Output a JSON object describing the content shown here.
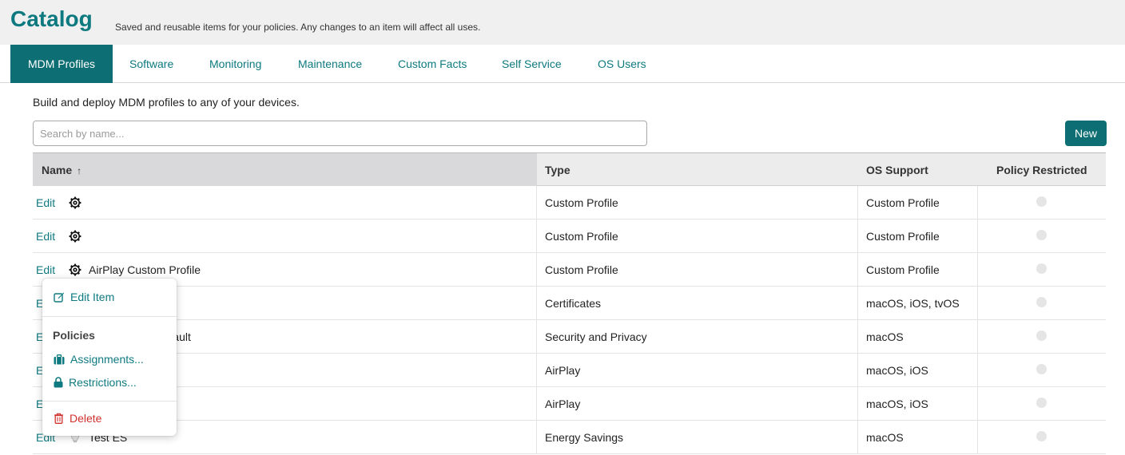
{
  "header": {
    "title": "Catalog",
    "subtitle": "Saved and reusable items for your policies. Any changes to an item will affect all uses."
  },
  "tabs": [
    {
      "label": "MDM Profiles",
      "active": true
    },
    {
      "label": "Software"
    },
    {
      "label": "Monitoring"
    },
    {
      "label": "Maintenance"
    },
    {
      "label": "Custom Facts"
    },
    {
      "label": "Self Service"
    },
    {
      "label": "OS Users"
    }
  ],
  "main": {
    "description": "Build and deploy MDM profiles to any of your devices.",
    "search_placeholder": "Search by name...",
    "new_label": "New"
  },
  "table": {
    "columns": {
      "name": "Name",
      "sort_indicator": "↑",
      "type": "Type",
      "os": "OS Support",
      "restricted": "Policy Restricted"
    },
    "rows": [
      {
        "edit": "Edit",
        "icon": "gear-icon",
        "name": "",
        "type": "Custom Profile",
        "os": "Custom Profile"
      },
      {
        "edit": "Edit",
        "icon": "gear-icon",
        "name": "",
        "type": "Custom Profile",
        "os": "Custom Profile"
      },
      {
        "edit": "Edit",
        "icon": "gear-icon",
        "name": "AirPlay Custom Profile",
        "type": "Custom Profile",
        "os": "Custom Profile"
      },
      {
        "edit": "E",
        "name": "",
        "type": "Certificates",
        "os": "macOS, iOS, tvOS"
      },
      {
        "edit": "E",
        "name": "Vault",
        "type": "Security and Privacy",
        "os": "macOS"
      },
      {
        "edit": "E",
        "name": "",
        "type": "AirPlay",
        "os": "macOS, iOS"
      },
      {
        "edit": "E",
        "name": "",
        "type": "AirPlay",
        "os": "macOS, iOS"
      },
      {
        "edit": "Edit",
        "icon": "lightbulb-icon",
        "name": "Test ES",
        "type": "Energy Savings",
        "os": "macOS"
      }
    ]
  },
  "context_menu": {
    "edit_item": "Edit Item",
    "section_title": "Policies",
    "assignments": "Assignments...",
    "restrictions": "Restrictions...",
    "delete": "Delete"
  },
  "colors": {
    "accent": "#0d6e74",
    "link": "#0e7a80",
    "danger": "#d0312d"
  }
}
